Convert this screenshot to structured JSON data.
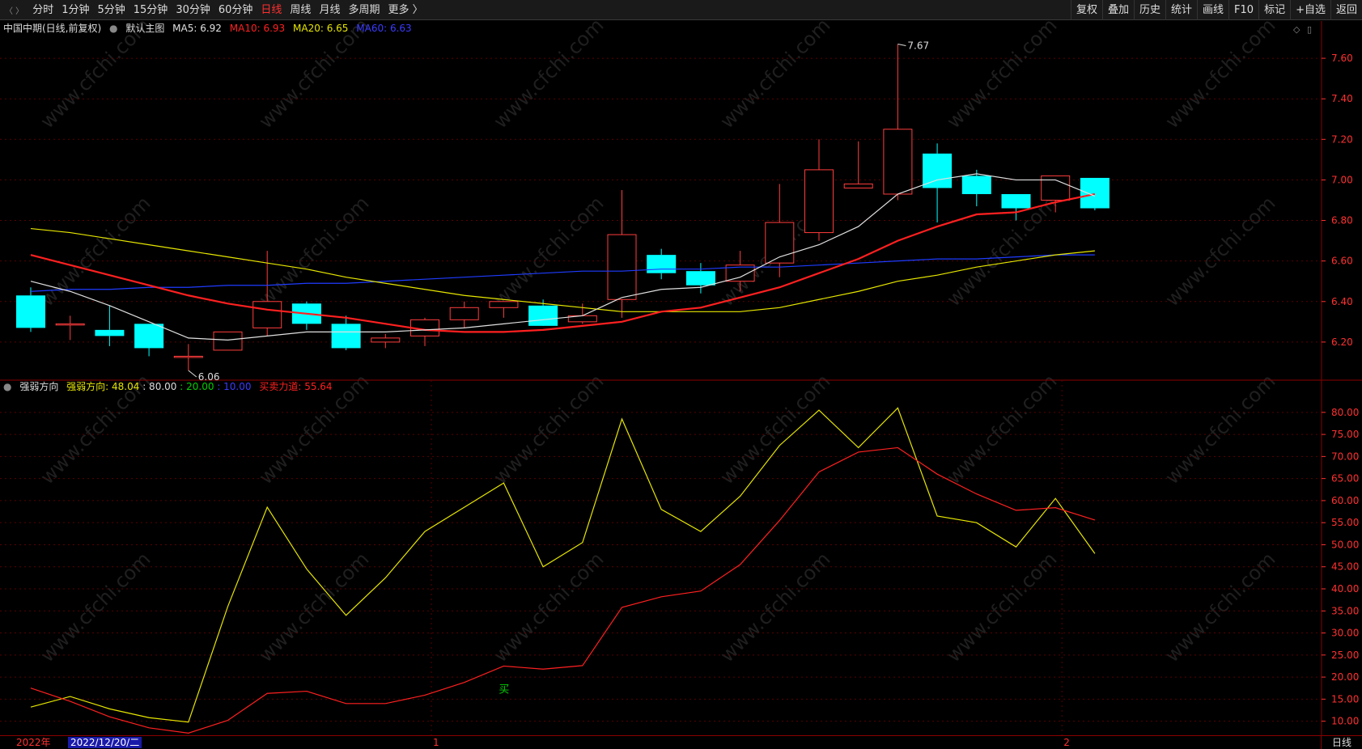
{
  "toolbar": {
    "periods": [
      {
        "label": "分时",
        "active": false
      },
      {
        "label": "1分钟",
        "active": false
      },
      {
        "label": "5分钟",
        "active": false
      },
      {
        "label": "15分钟",
        "active": false
      },
      {
        "label": "30分钟",
        "active": false
      },
      {
        "label": "60分钟",
        "active": false
      },
      {
        "label": "日线",
        "active": true
      },
      {
        "label": "周线",
        "active": false
      },
      {
        "label": "月线",
        "active": false
      },
      {
        "label": "多周期",
        "active": false
      },
      {
        "label": "更多 〉",
        "active": false
      }
    ],
    "tools": [
      "复权",
      "叠加",
      "历史",
      "统计",
      "画线",
      "F10",
      "标记",
      "+自选",
      "返回"
    ]
  },
  "main_info": {
    "title": "中国中期(日线,前复权)",
    "template": "默认主图",
    "ma5": "MA5: 6.92",
    "ma10": "MA10: 6.93",
    "ma20": "MA20: 6.65",
    "ma60": "MA60: 6.63"
  },
  "sub_info": {
    "title": "强弱方向",
    "v1": "强弱方向: 48.04",
    "v2": ": 80.00",
    "v3": ": 20.00",
    "v4": ": 10.00",
    "v5": "买卖力道: 55.64"
  },
  "colors": {
    "up": "#ff3c3c",
    "down": "#00ffff",
    "ma5": "#e0e0e0",
    "ma10": "#ff2020",
    "ma20": "#e6e600",
    "ma60": "#1e3cff",
    "line1": "#e6e600",
    "line2": "#ff2020",
    "grid": "#5a0000",
    "axis": "#ff3030",
    "green": "#00d000",
    "blue": "#3b3bff"
  },
  "chart_data": [
    {
      "type": "candlestick",
      "ylim": [
        6.02,
        7.72
      ],
      "yticks": [
        6.2,
        6.4,
        6.6,
        6.8,
        7.0,
        7.2,
        7.4,
        7.6
      ],
      "annotations": [
        {
          "text": "7.67",
          "index": 22
        },
        {
          "text": "6.06",
          "index": 4
        }
      ],
      "candles": [
        {
          "o": 6.43,
          "h": 6.47,
          "l": 6.25,
          "c": 6.27
        },
        {
          "o": 6.29,
          "h": 6.33,
          "l": 6.21,
          "c": 6.29
        },
        {
          "o": 6.26,
          "h": 6.38,
          "l": 6.18,
          "c": 6.23
        },
        {
          "o": 6.29,
          "h": 6.29,
          "l": 6.13,
          "c": 6.17
        },
        {
          "o": 6.13,
          "h": 6.19,
          "l": 6.06,
          "c": 6.13
        },
        {
          "o": 6.16,
          "h": 6.24,
          "l": 6.16,
          "c": 6.25
        },
        {
          "o": 6.27,
          "h": 6.65,
          "l": 6.23,
          "c": 6.4
        },
        {
          "o": 6.39,
          "h": 6.4,
          "l": 6.26,
          "c": 6.29
        },
        {
          "o": 6.29,
          "h": 6.33,
          "l": 6.16,
          "c": 6.17
        },
        {
          "o": 6.2,
          "h": 6.24,
          "l": 6.17,
          "c": 6.22
        },
        {
          "o": 6.23,
          "h": 6.32,
          "l": 6.18,
          "c": 6.31
        },
        {
          "o": 6.31,
          "h": 6.4,
          "l": 6.27,
          "c": 6.37
        },
        {
          "o": 6.37,
          "h": 6.4,
          "l": 6.32,
          "c": 6.4
        },
        {
          "o": 6.38,
          "h": 6.41,
          "l": 6.29,
          "c": 6.28
        },
        {
          "o": 6.3,
          "h": 6.39,
          "l": 6.29,
          "c": 6.33
        },
        {
          "o": 6.41,
          "h": 6.95,
          "l": 6.32,
          "c": 6.73
        },
        {
          "o": 6.63,
          "h": 6.66,
          "l": 6.51,
          "c": 6.54
        },
        {
          "o": 6.55,
          "h": 6.59,
          "l": 6.44,
          "c": 6.48
        },
        {
          "o": 6.5,
          "h": 6.65,
          "l": 6.45,
          "c": 6.58
        },
        {
          "o": 6.59,
          "h": 6.98,
          "l": 6.52,
          "c": 6.79
        },
        {
          "o": 6.74,
          "h": 7.2,
          "l": 6.7,
          "c": 7.05
        },
        {
          "o": 6.96,
          "h": 7.19,
          "l": 6.96,
          "c": 6.98
        },
        {
          "o": 6.93,
          "h": 7.67,
          "l": 6.9,
          "c": 7.25
        },
        {
          "o": 7.13,
          "h": 7.18,
          "l": 6.79,
          "c": 6.96
        },
        {
          "o": 7.02,
          "h": 7.05,
          "l": 6.87,
          "c": 6.93
        },
        {
          "o": 6.93,
          "h": 6.93,
          "l": 6.8,
          "c": 6.86
        },
        {
          "o": 6.9,
          "h": 7.02,
          "l": 6.84,
          "c": 7.02
        },
        {
          "o": 7.01,
          "h": 7.01,
          "l": 6.85,
          "c": 6.86
        }
      ],
      "ma5": [
        6.5,
        6.45,
        6.38,
        6.3,
        6.22,
        6.21,
        6.23,
        6.25,
        6.25,
        6.25,
        6.26,
        6.27,
        6.29,
        6.31,
        6.33,
        6.42,
        6.46,
        6.47,
        6.52,
        6.62,
        6.68,
        6.77,
        6.93,
        7.0,
        7.03,
        7.0,
        7.0,
        6.92
      ],
      "ma10": [
        6.63,
        6.58,
        6.53,
        6.48,
        6.43,
        6.39,
        6.36,
        6.34,
        6.32,
        6.29,
        6.26,
        6.25,
        6.25,
        6.26,
        6.28,
        6.3,
        6.35,
        6.37,
        6.42,
        6.47,
        6.54,
        6.61,
        6.7,
        6.77,
        6.83,
        6.84,
        6.89,
        6.93
      ],
      "ma20": [
        6.76,
        6.74,
        6.71,
        6.68,
        6.65,
        6.62,
        6.59,
        6.56,
        6.52,
        6.49,
        6.46,
        6.43,
        6.41,
        6.39,
        6.37,
        6.35,
        6.35,
        6.35,
        6.35,
        6.37,
        6.41,
        6.45,
        6.5,
        6.53,
        6.57,
        6.6,
        6.63,
        6.65
      ],
      "ma60": [
        6.45,
        6.46,
        6.46,
        6.47,
        6.47,
        6.48,
        6.48,
        6.49,
        6.49,
        6.5,
        6.51,
        6.52,
        6.53,
        6.54,
        6.55,
        6.55,
        6.56,
        6.56,
        6.57,
        6.57,
        6.58,
        6.59,
        6.6,
        6.61,
        6.61,
        6.62,
        6.63,
        6.63
      ]
    },
    {
      "type": "line",
      "ylim": [
        7,
        84
      ],
      "yticks": [
        10,
        15,
        20,
        25,
        30,
        35,
        40,
        45,
        50,
        55,
        60,
        65,
        70,
        75,
        80
      ],
      "series": [
        {
          "name": "强弱方向",
          "values": [
            13.2,
            15.6,
            12.8,
            10.8,
            9.8,
            36,
            58.5,
            44.5,
            34,
            42.5,
            53,
            58.5,
            64,
            45,
            50.5,
            78.5,
            58,
            53,
            61,
            72.5,
            80.5,
            72,
            81,
            56.5,
            55,
            49.5,
            60.5,
            48
          ]
        },
        {
          "name": "买卖力道",
          "values": [
            17.5,
            14.5,
            11,
            8.5,
            7.3,
            10.2,
            16.3,
            16.8,
            14,
            14,
            15.9,
            18.8,
            22.5,
            21.8,
            22.6,
            35.8,
            38.2,
            39.5,
            45.5,
            55.5,
            66.5,
            71,
            72,
            66,
            61.5,
            57.8,
            58.4,
            55.6
          ]
        }
      ],
      "signal": {
        "text": "买",
        "index": 12,
        "value": 17.5
      }
    }
  ],
  "timebar": {
    "year": "2022年",
    "cursor_date": "2022/12/20/二",
    "months": [
      {
        "text": "1",
        "index": 10
      },
      {
        "text": "2",
        "index": 26
      }
    ],
    "period": "日线"
  },
  "watermark": "www.cfchi.com"
}
